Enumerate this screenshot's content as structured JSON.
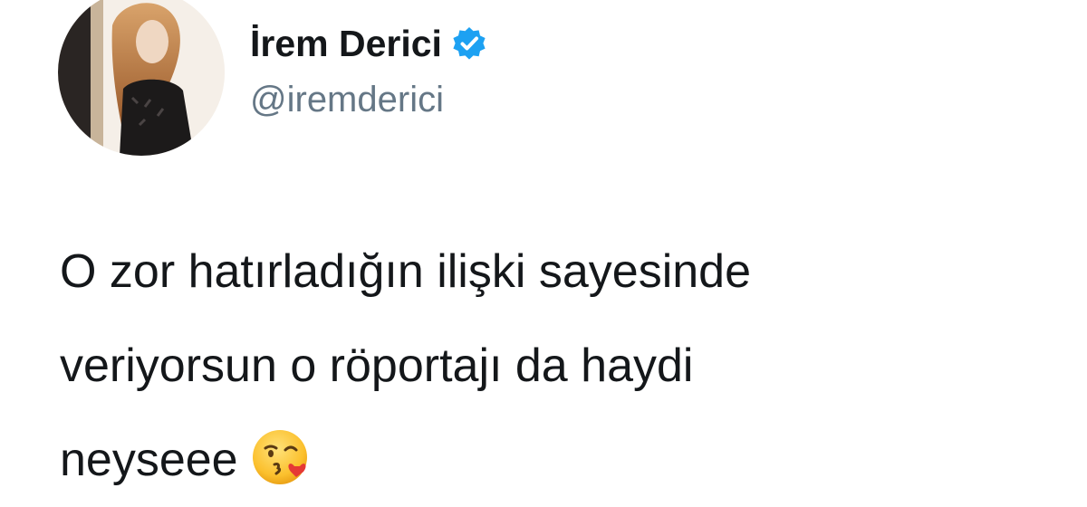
{
  "tweet": {
    "author": {
      "display_name": "İrem Derici",
      "handle": "@iremderici",
      "verified": true,
      "verified_badge_icon": "verified-badge-icon",
      "verified_color": "#1da1f2"
    },
    "text_lines": [
      "O zor hatırladığın ilişki sayesinde",
      "veriyorsun o röportajı da haydi",
      "neyseee"
    ],
    "emoji": "face-blowing-a-kiss-icon"
  },
  "colors": {
    "text": "#14171a",
    "secondary_text": "#657786",
    "background": "#ffffff"
  }
}
